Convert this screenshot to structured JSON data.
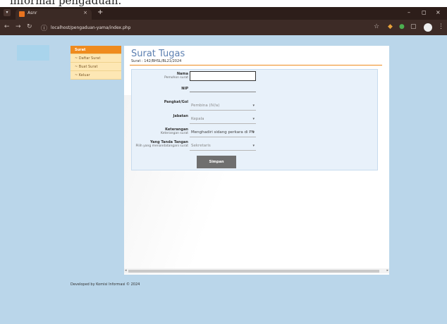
{
  "caption_text": "informal pengaduan.",
  "browser": {
    "tab_title": "Asnr",
    "tab_close": "×",
    "new_tab": "+",
    "tab_menu": "▾",
    "url": "localhost/pengaduan-yama/index.php",
    "window_controls": [
      "–",
      "◻",
      "×"
    ]
  },
  "sidebar": {
    "items": [
      {
        "label": "Surat",
        "active": true
      },
      {
        "label": "~ Daftar Surat",
        "active": false
      },
      {
        "label": "~ Buat Surat",
        "active": false
      },
      {
        "label": "~ Keluar",
        "active": false
      }
    ]
  },
  "page": {
    "title": "Surat Tugas",
    "subtitle": "Surat : 142/BHSL/BL21/2024"
  },
  "form": {
    "nama_label": "Nama",
    "nama_sub": "Pemohon surat",
    "nip_label": "NIP",
    "pangkat_label": "Pangkat/Gol",
    "pangkat_value": "Pembina (IV/a)",
    "jabatan_label": "Jabatan",
    "jabatan_value": "Kepala",
    "keterangan_label": "Keterangan",
    "keterangan_sub": "Keterangan surat",
    "keterangan_value": "Menghadiri sidang perkara di PN",
    "ttd_label": "Yang Tanda Tangan",
    "ttd_sub": "Pilih yang menandatangani surat",
    "ttd_value": "Sekretaris",
    "submit_label": "Simpan"
  },
  "footer": {
    "text": "Developed by Komisi Informasi © 2024"
  }
}
